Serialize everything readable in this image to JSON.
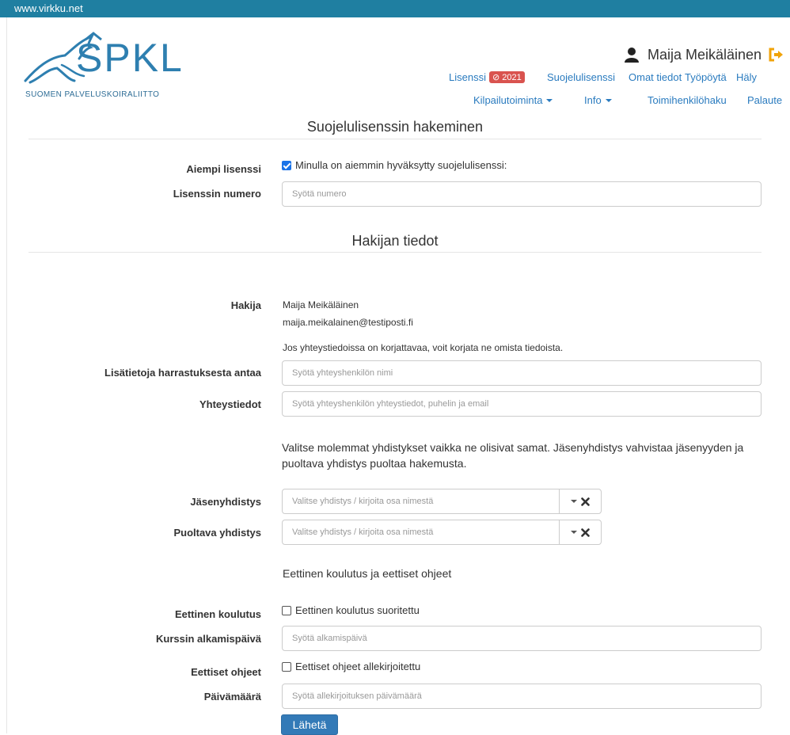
{
  "browser": {
    "site": "www.virkku.net"
  },
  "logo": {
    "text": "SPKL",
    "subtitle": "SUOMEN PALVELUSKOIRALIITTO"
  },
  "user": {
    "name": "Maija Meikäläinen"
  },
  "nav": {
    "row1": {
      "lisenssi": "Lisenssi",
      "lisenssi_badge": "2021",
      "suojelulisenssi": "Suojelulisenssi",
      "omat_tiedot": "Omat tiedot",
      "tyopoyta": "Työpöytä",
      "haly": "Häly"
    },
    "row2": {
      "kilpailutoiminta": "Kilpailutoiminta",
      "info": "Info",
      "toimihenkilohaku": "Toimihenkilöhaku",
      "palaute": "Palaute"
    }
  },
  "section1": {
    "title": "Suojelulisenssin hakeminen"
  },
  "aiempi": {
    "label": "Aiempi lisenssi",
    "checkbox_label": "Minulla on aiemmin hyväksytty suojelulisenssi:",
    "checked": true
  },
  "lisenssin_numero": {
    "label": "Lisenssin numero",
    "placeholder": "Syötä numero"
  },
  "section2": {
    "title": "Hakijan tiedot"
  },
  "hakija": {
    "label": "Hakija",
    "name": "Maija Meikäläinen",
    "email": "maija.meikalainen@testiposti.fi",
    "note": "Jos yhteystiedoissa on korjattavaa, voit korjata ne omista tiedoista."
  },
  "lisatietoja": {
    "label": "Lisätietoja harrastuksesta antaa",
    "placeholder": "Syötä yhteyshenkilön nimi"
  },
  "yhteystiedot": {
    "label": "Yhteystiedot",
    "placeholder": "Syötä yhteyshenkilön yhteystiedot, puhelin ja email"
  },
  "yhdistys_info": "Valitse molemmat yhdistykset vaikka ne olisivat samat. Jäsenyhdistys vahvistaa jäsenyyden ja puoltava yhdistys puoltaa hakemusta.",
  "jasenyhdistys": {
    "label": "Jäsenyhdistys",
    "placeholder": "Valitse yhdistys / kirjoita osa nimestä"
  },
  "puoltava": {
    "label": "Puoltava yhdistys",
    "placeholder": "Valitse yhdistys / kirjoita osa nimestä"
  },
  "eettinen_heading": "Eettinen koulutus ja eettiset ohjeet",
  "eettinen_koulutus": {
    "label": "Eettinen koulutus",
    "checkbox_label": "Eettinen koulutus suoritettu",
    "checked": false
  },
  "kurssin_alkamispaiva": {
    "label": "Kurssin alkamispäivä",
    "placeholder": "Syötä alkamispäivä"
  },
  "eettiset_ohjeet": {
    "label": "Eettiset ohjeet",
    "checkbox_label": "Eettiset ohjeet allekirjoitettu",
    "checked": false
  },
  "paivamaara": {
    "label": "Päivämäärä",
    "placeholder": "Syötä allekirjoituksen päivämäärä"
  },
  "submit": {
    "label": "Lähetä"
  },
  "colors": {
    "topbar": "#1f7fa1",
    "link": "#2a7bbf",
    "badge": "#d9534f",
    "button": "#337ab7",
    "logo": "#2e7fb0",
    "logout_icon": "#f0a30a"
  }
}
